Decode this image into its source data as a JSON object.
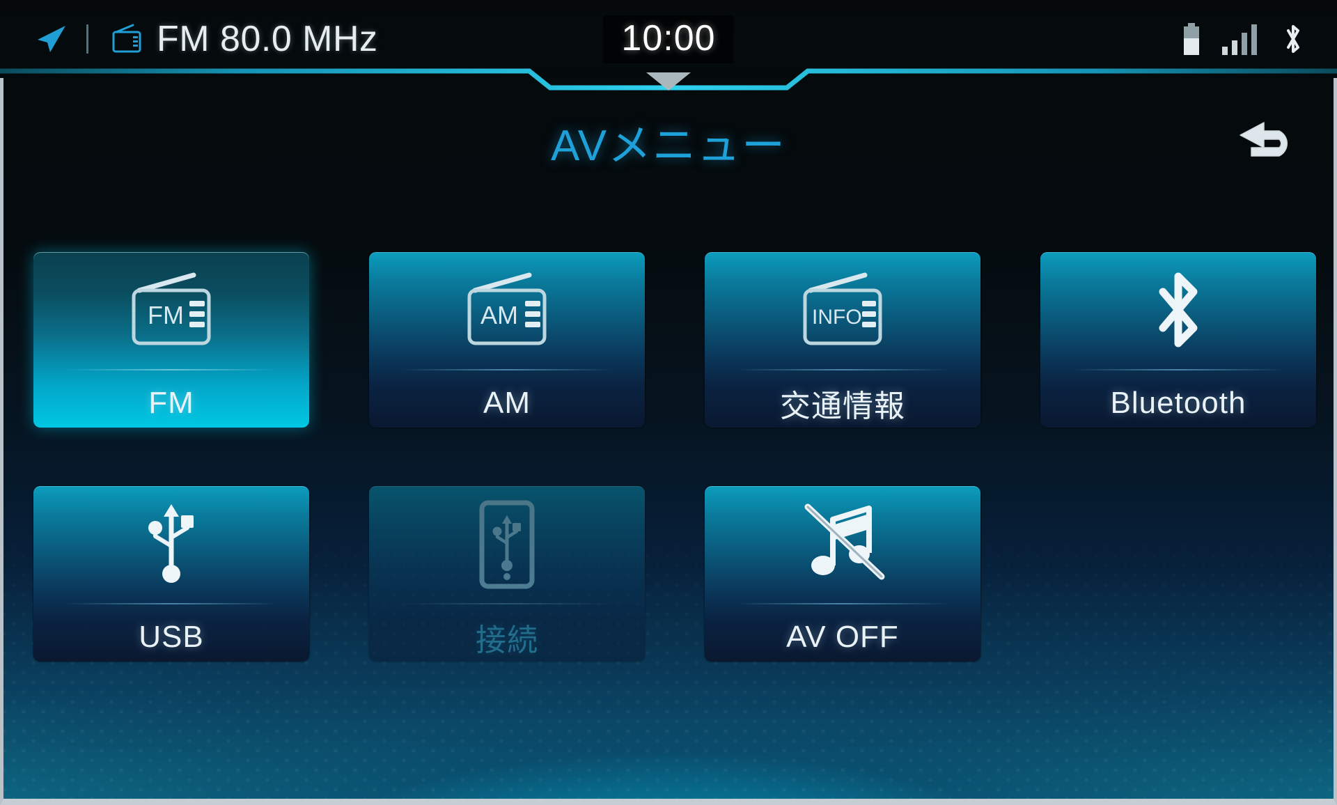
{
  "status_bar": {
    "nav_icon": "navigation-arrow-icon",
    "source_icon": "radio-icon",
    "source_text": "FM 80.0 MHz",
    "clock": "10:00",
    "right_icons": [
      {
        "name": "battery-icon",
        "level_pct": 58
      },
      {
        "name": "signal-bars-icon",
        "bars": 4
      },
      {
        "name": "bluetooth-icon"
      }
    ]
  },
  "header": {
    "title": "AVメニュー",
    "back_label": "back-arrow-icon",
    "title_color": "#1ea0d8"
  },
  "menu": {
    "rows": 2,
    "columns": 4,
    "tiles": [
      {
        "id": "fm",
        "label": "FM",
        "icon": "radio-fm-icon",
        "icon_text": "FM",
        "state": "selected"
      },
      {
        "id": "am",
        "label": "AM",
        "icon": "radio-am-icon",
        "icon_text": "AM",
        "state": "normal"
      },
      {
        "id": "traffic",
        "label": "交通情報",
        "icon": "radio-info-icon",
        "icon_text": "INFO",
        "state": "normal"
      },
      {
        "id": "bluetooth",
        "label": "Bluetooth",
        "icon": "bluetooth-icon",
        "icon_text": "",
        "state": "normal"
      },
      {
        "id": "usb",
        "label": "USB",
        "icon": "usb-icon",
        "icon_text": "",
        "state": "normal"
      },
      {
        "id": "connect",
        "label": "接続",
        "icon": "phone-usb-icon",
        "icon_text": "",
        "state": "disabled"
      },
      {
        "id": "av_off",
        "label": "AV OFF",
        "icon": "music-note-off-icon",
        "icon_text": "",
        "state": "normal"
      }
    ]
  },
  "theme": {
    "accent_cyan": "#00c8e4",
    "title_cyan": "#1ea0d8",
    "tile_top": "#0c9dbe",
    "tile_bottom": "#0a1830",
    "text_light": "#e9f2f6",
    "background_bottom_glow": "#0d6a86"
  }
}
